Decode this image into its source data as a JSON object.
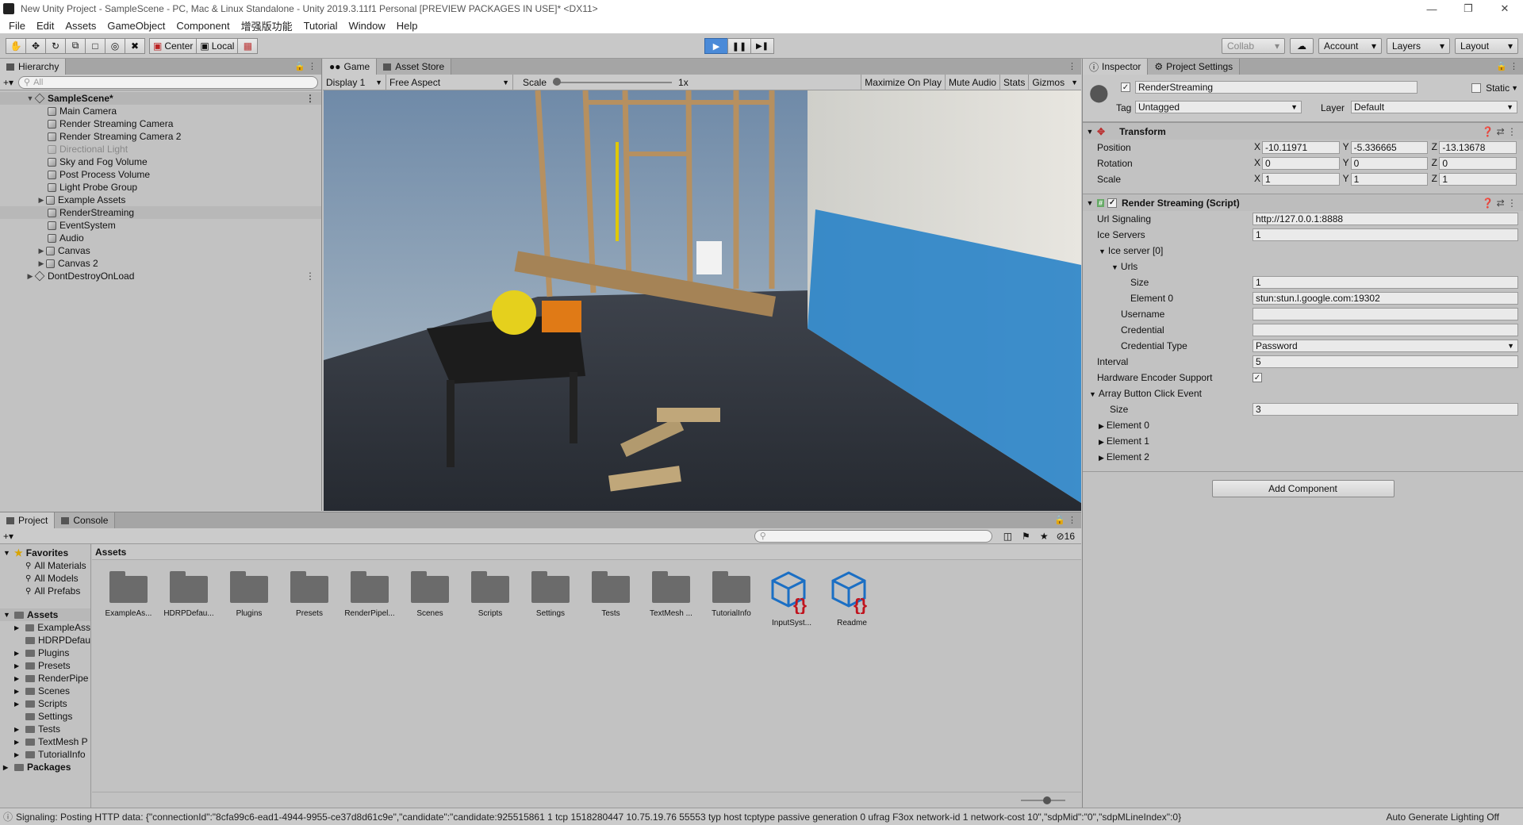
{
  "window": {
    "title": "New Unity Project - SampleScene - PC, Mac & Linux Standalone - Unity 2019.3.11f1 Personal [PREVIEW PACKAGES IN USE]* <DX11>"
  },
  "menu": [
    "File",
    "Edit",
    "Assets",
    "GameObject",
    "Component",
    "增强版功能",
    "Tutorial",
    "Window",
    "Help"
  ],
  "toolbar": {
    "pivot": "Center",
    "space": "Local",
    "collab": "Collab",
    "account": "Account",
    "layers": "Layers",
    "layout": "Layout"
  },
  "hierarchy": {
    "tab": "Hierarchy",
    "search_placeholder": "All",
    "scene": "SampleScene*",
    "items": [
      "Main Camera",
      "Render Streaming Camera",
      "Render Streaming Camera 2",
      "Directional Light",
      "Sky and Fog Volume",
      "Post Process Volume",
      "Light Probe Group",
      "Example Assets",
      "RenderStreaming",
      "EventSystem",
      "Audio",
      "Canvas",
      "Canvas 2"
    ],
    "dont_destroy": "DontDestroyOnLoad"
  },
  "game": {
    "tab_game": "Game",
    "tab_store": "Asset Store",
    "display": "Display 1",
    "aspect": "Free Aspect",
    "scale_label": "Scale",
    "scale_value": "1x",
    "maximize": "Maximize On Play",
    "mute": "Mute Audio",
    "stats": "Stats",
    "gizmos": "Gizmos"
  },
  "inspector": {
    "tab": "Inspector",
    "tab2": "Project Settings",
    "object_name": "RenderStreaming",
    "static_label": "Static",
    "tag_label": "Tag",
    "tag_value": "Untagged",
    "layer_label": "Layer",
    "layer_value": "Default",
    "transform": {
      "title": "Transform",
      "position_label": "Position",
      "rotation_label": "Rotation",
      "scale_label": "Scale",
      "position": [
        "-10.11971",
        "-5.336665",
        "-13.13678"
      ],
      "rotation": [
        "0",
        "0",
        "0"
      ],
      "scale": [
        "1",
        "1",
        "1"
      ]
    },
    "script": {
      "title": "Render Streaming (Script)",
      "url_label": "Url Signaling",
      "url_value": "http://127.0.0.1:8888",
      "ice_label": "Ice Servers",
      "ice_value": "1",
      "ice0_label": "Ice server [0]",
      "urls_label": "Urls",
      "size_label": "Size",
      "urls_size": "1",
      "element0_label": "Element 0",
      "element0_value": "stun:stun.l.google.com:19302",
      "username_label": "Username",
      "credential_label": "Credential",
      "credtype_label": "Credential Type",
      "credtype_value": "Password",
      "interval_label": "Interval",
      "interval_value": "5",
      "hw_label": "Hardware Encoder Support",
      "array_label": "Array Button Click Event",
      "array_size": "3",
      "elements": [
        "Element 0",
        "Element 1",
        "Element 2"
      ]
    },
    "add_component": "Add Component"
  },
  "project": {
    "tab": "Project",
    "tab2": "Console",
    "favorites": "Favorites",
    "fav_items": [
      "All Materials",
      "All Models",
      "All Prefabs"
    ],
    "assets": "Assets",
    "asset_tree": [
      "ExampleAss",
      "HDRPDefau",
      "Plugins",
      "Presets",
      "RenderPipe",
      "Scenes",
      "Scripts",
      "Settings",
      "Tests",
      "TextMesh P",
      "TutorialInfo"
    ],
    "packages": "Packages",
    "breadcrumb": "Assets",
    "hidden_count": "16",
    "grid": [
      "ExampleAs...",
      "HDRPDefau...",
      "Plugins",
      "Presets",
      "RenderPipel...",
      "Scenes",
      "Scripts",
      "Settings",
      "Tests",
      "TextMesh ...",
      "TutorialInfo",
      "InputSyst...",
      "Readme"
    ]
  },
  "status": {
    "message": "Signaling: Posting HTTP data: {\"connectionId\":\"8cfa99c6-ead1-4944-9955-ce37d8d61c9e\",\"candidate\":\"candidate:925515861 1 tcp 1518280447 10.75.19.76 55553 typ host tcptype passive generation 0 ufrag F3ox network-id 1 network-cost 10\",\"sdpMid\":\"0\",\"sdpMLineIndex\":0}",
    "right": "Auto Generate Lighting Off"
  },
  "colors": {
    "play_active": "#4a8ad8",
    "script_icon": "#1b6fc4",
    "script_braces": "#c0141e"
  }
}
